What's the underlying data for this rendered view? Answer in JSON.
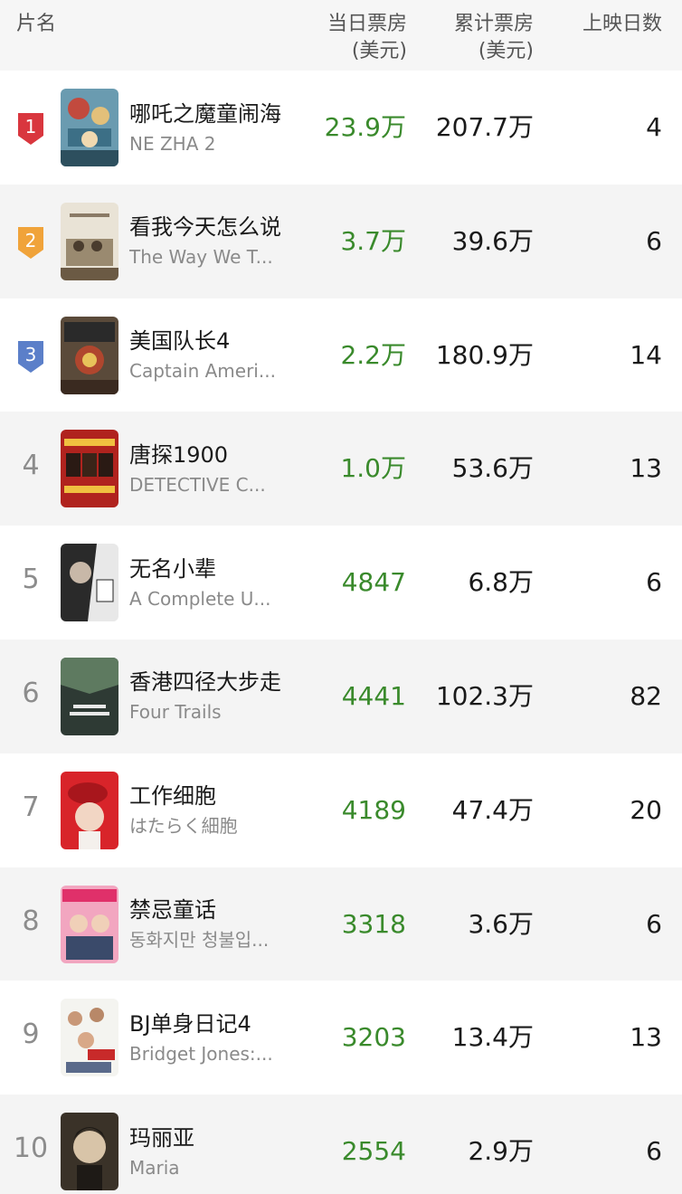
{
  "header": {
    "name": "片名",
    "daily": "当日票房",
    "daily_unit": "(美元)",
    "total": "累计票房",
    "total_unit": "(美元)",
    "days": "上映日数"
  },
  "colors": {
    "accent_green": "#3a8a2c",
    "rank1": "#d9363e",
    "rank2": "#f0a33a",
    "rank3": "#5b7fc9"
  },
  "rows": [
    {
      "rank": "1",
      "cn": "哪吒之魔童闹海",
      "en": "NE ZHA 2",
      "daily": "23.9万",
      "total": "207.7万",
      "days": "4"
    },
    {
      "rank": "2",
      "cn": "看我今天怎么说",
      "en": "The Way We T...",
      "daily": "3.7万",
      "total": "39.6万",
      "days": "6"
    },
    {
      "rank": "3",
      "cn": "美国队长4",
      "en": "Captain Ameri...",
      "daily": "2.2万",
      "total": "180.9万",
      "days": "14"
    },
    {
      "rank": "4",
      "cn": "唐探1900",
      "en": "DETECTIVE C...",
      "daily": "1.0万",
      "total": "53.6万",
      "days": "13"
    },
    {
      "rank": "5",
      "cn": "无名小辈",
      "en": "A Complete U...",
      "daily": "4847",
      "total": "6.8万",
      "days": "6"
    },
    {
      "rank": "6",
      "cn": "香港四径大步走",
      "en": "Four Trails",
      "daily": "4441",
      "total": "102.3万",
      "days": "82"
    },
    {
      "rank": "7",
      "cn": "工作细胞",
      "en": "はたらく細胞",
      "daily": "4189",
      "total": "47.4万",
      "days": "20"
    },
    {
      "rank": "8",
      "cn": "禁忌童话",
      "en": "동화지만 청불입...",
      "daily": "3318",
      "total": "3.6万",
      "days": "6"
    },
    {
      "rank": "9",
      "cn": "BJ单身日记4",
      "en": "Bridget Jones:...",
      "daily": "3203",
      "total": "13.4万",
      "days": "13"
    },
    {
      "rank": "10",
      "cn": "玛丽亚",
      "en": "Maria",
      "daily": "2554",
      "total": "2.9万",
      "days": "6"
    }
  ]
}
